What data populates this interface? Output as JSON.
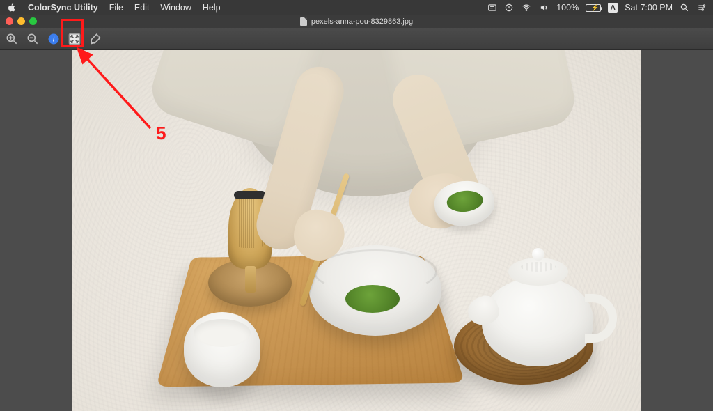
{
  "menubar": {
    "app_name": "ColorSync Utility",
    "items": [
      "File",
      "Edit",
      "Window",
      "Help"
    ],
    "status": {
      "battery_percent": "100%",
      "input_indicator": "A",
      "clock": "Sat 7:00 PM"
    }
  },
  "window": {
    "title": "pexels-anna-pou-8329863.jpg"
  },
  "toolbar": {
    "zoom_in": "zoom-in",
    "zoom_out": "zoom-out",
    "info": "info",
    "fit": "zoom-to-fit",
    "adjust": "image-correction"
  },
  "annotation": {
    "label": "5",
    "target": "zoom-to-fit"
  },
  "colors": {
    "annotation": "#ff1a1a",
    "menubar_bg": "#383838",
    "toolbar_bg": "#454545"
  }
}
